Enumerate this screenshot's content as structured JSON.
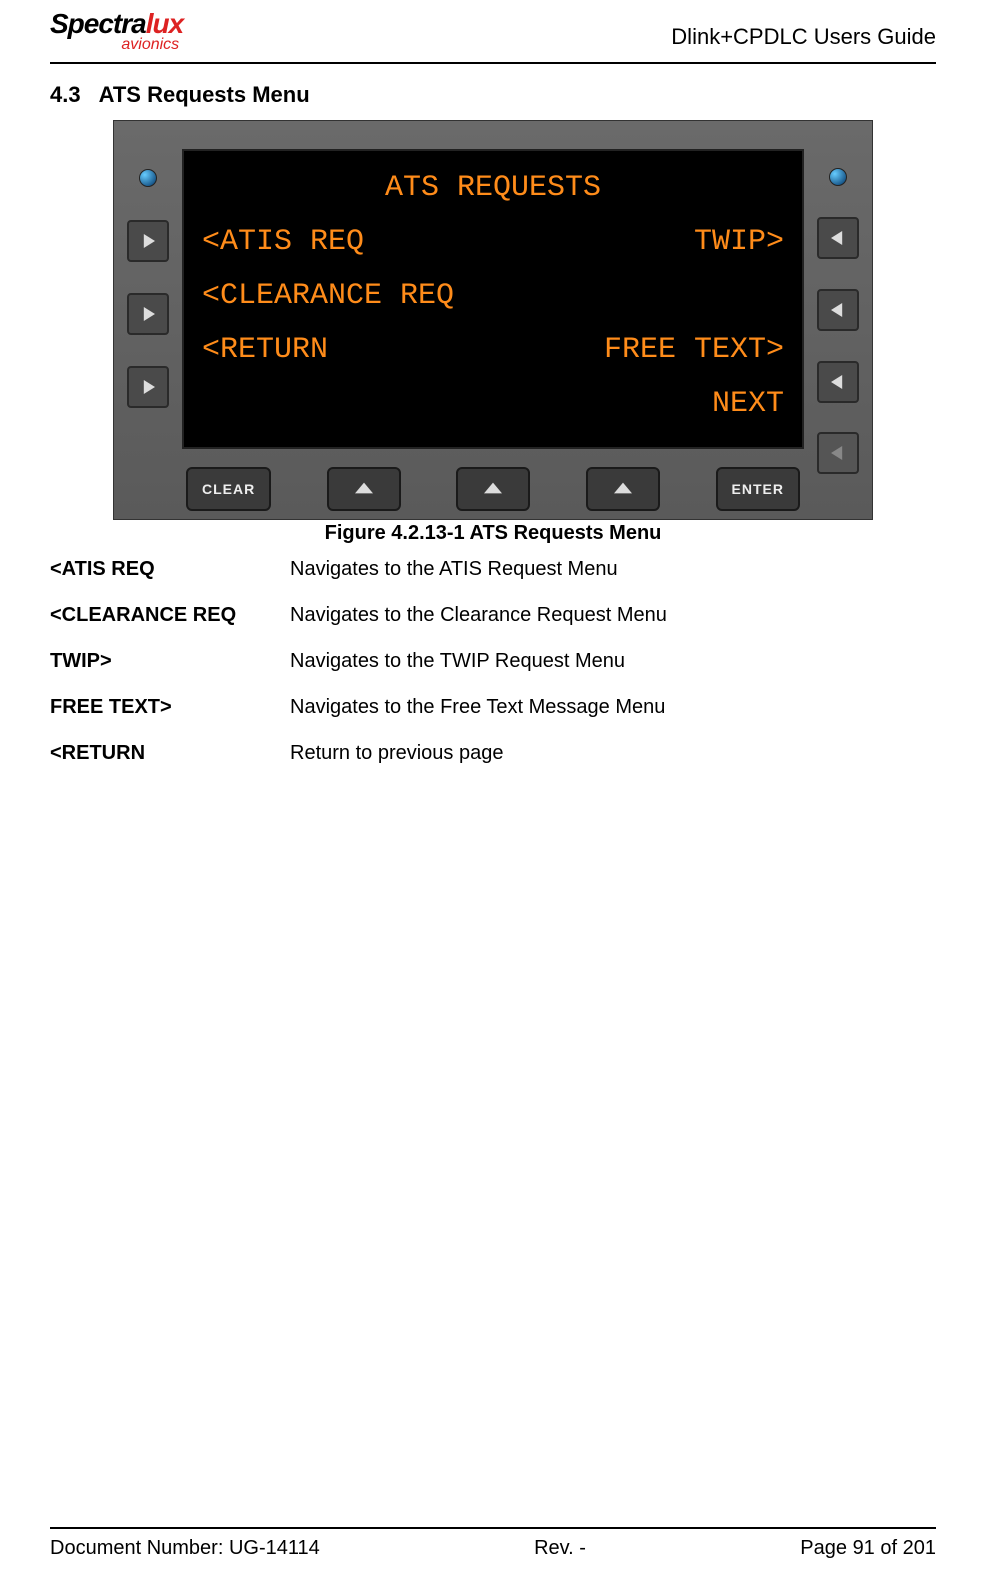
{
  "header": {
    "logo_main": "Spectralux",
    "logo_sub": "avionics",
    "doc_title": "Dlink+CPDLC Users Guide"
  },
  "section": {
    "number": "4.3",
    "title": "ATS Requests Menu"
  },
  "screen": {
    "title": "ATS REQUESTS",
    "row1_left": "<ATIS REQ",
    "row1_right": "TWIP>",
    "row2_left": "<CLEARANCE REQ",
    "row2_right": "",
    "row3_left": "<RETURN",
    "row3_right": "FREE TEXT>",
    "row4_left": "",
    "row4_right": "NEXT"
  },
  "bottom_buttons": {
    "clear": "CLEAR",
    "enter": "ENTER"
  },
  "figure_caption": "Figure 4.2.13-1 ATS Requests Menu",
  "descriptions": [
    {
      "term": "<ATIS REQ",
      "desc": "Navigates to the ATIS Request Menu"
    },
    {
      "term": "<CLEARANCE REQ",
      "desc": "Navigates to the Clearance Request Menu"
    },
    {
      "term": "TWIP>",
      "desc": "Navigates to the TWIP Request Menu"
    },
    {
      "term": "FREE TEXT>",
      "desc": "Navigates to the Free Text Message Menu"
    },
    {
      "term": "<RETURN",
      "desc": "Return to previous page"
    }
  ],
  "footer": {
    "doc_number": "Document Number:  UG-14114",
    "rev": "Rev. -",
    "page": "Page 91 of 201"
  }
}
